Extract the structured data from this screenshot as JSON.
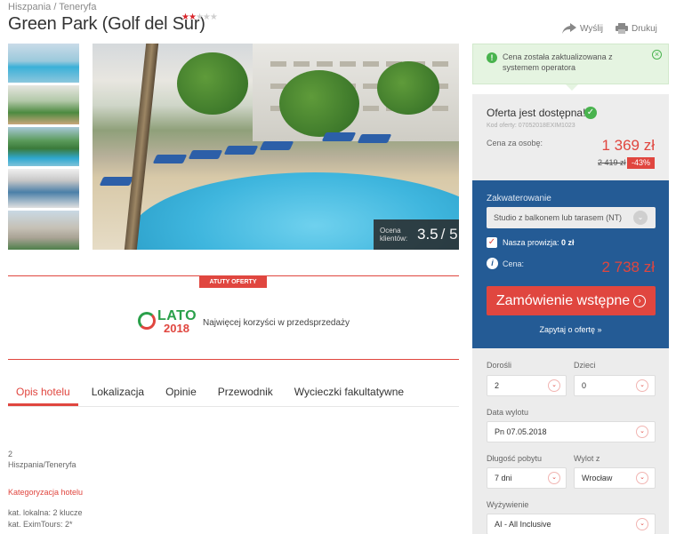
{
  "header": {
    "breadcrumb": "Hiszpania / Teneryfa",
    "title": "Green Park (Golf del Sur)",
    "stars_on": "★★",
    "stars_off": "★★★",
    "share_label": "Wyślij",
    "print_label": "Drukuj"
  },
  "gallery": {
    "rating_label": "Ocena klientów:",
    "rating_value": "3.5",
    "rating_max": "/ 5"
  },
  "promo": {
    "badge": "ATUTY OFERTY",
    "logo_word": "LATO",
    "logo_year": "2018",
    "text": "Najwięcej korzyści w przedsprzedaży"
  },
  "tabs": [
    {
      "label": "Opis hotelu",
      "active": true
    },
    {
      "label": "Lokalizacja"
    },
    {
      "label": "Opinie"
    },
    {
      "label": "Przewodnik"
    },
    {
      "label": "Wycieczki fakultatywne"
    }
  ],
  "hotel_info": {
    "number": "2",
    "location": "Hiszpania/Teneryfa",
    "category_title": "Kategoryzacja hotelu",
    "local_category": "kat. lokalna: 2 klucze",
    "exim_category": "kat. EximTours: 2*"
  },
  "notice": {
    "text": "Cena została zaktualizowana z systemem operatora",
    "icon": "!",
    "close": "×"
  },
  "offer": {
    "title": "Oferta jest dostępna!",
    "code": "Kod oferty: 07052018EXIM1023",
    "price_label": "Cena za osobę:",
    "price": "1 369 zł",
    "old_price": "2 419 zł",
    "discount": "-43%"
  },
  "booking": {
    "accommodation_label": "Zakwaterowanie",
    "accommodation_value": "Studio z balkonem lub tarasem (NT)",
    "commission_label": "Nasza prowizja:",
    "commission_value": "0 zł",
    "total_label": "Cena:",
    "total": "2 738 zł",
    "order_button": "Zamówienie wstępne",
    "ask_link": "Zapytaj o ofertę »"
  },
  "filters": {
    "adults_label": "Dorośli",
    "adults_value": "2",
    "children_label": "Dzieci",
    "children_value": "0",
    "date_label": "Data wylotu",
    "date_value": "Pn 07.05.2018",
    "duration_label": "Długość pobytu",
    "duration_value": "7 dni",
    "departure_label": "Wylot z",
    "departure_value": "Wrocław",
    "board_label": "Wyżywienie",
    "board_value": "AI - All Inclusive"
  },
  "colors": {
    "accent_red": "#e0463f",
    "booking_blue": "#245b95",
    "success_green": "#49b34e"
  },
  "icons": [
    "share-icon",
    "print-icon",
    "check-circle-icon",
    "info-icon",
    "chevron-down-icon",
    "close-icon",
    "arrow-right-icon"
  ]
}
